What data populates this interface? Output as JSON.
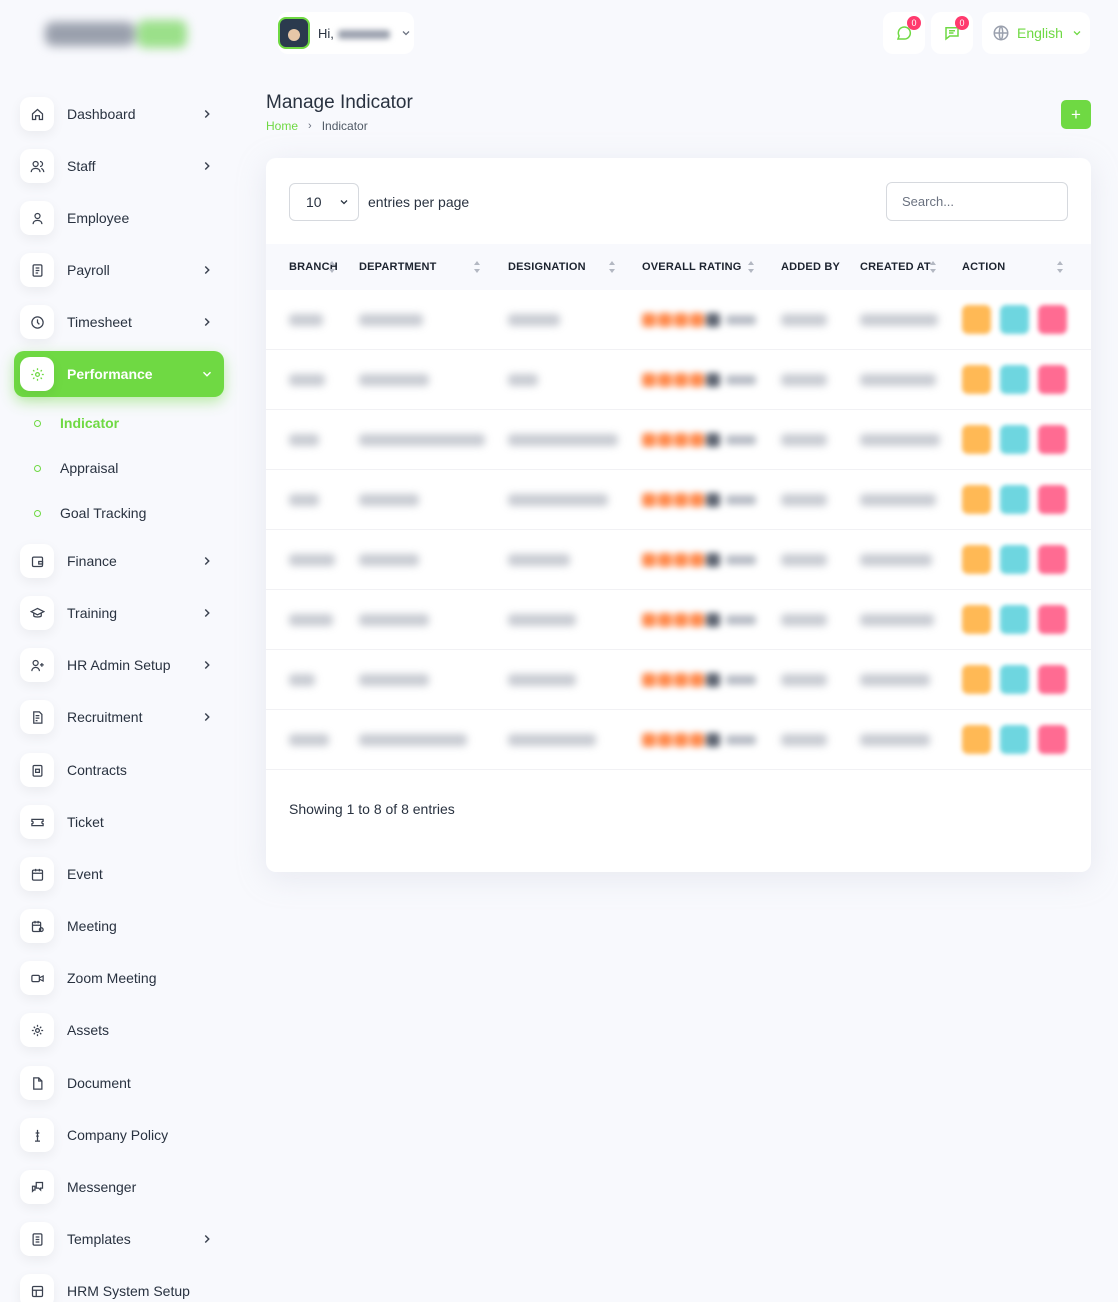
{
  "sidebar": {
    "items": [
      {
        "label": "Dashboard",
        "icon": "home-icon",
        "chevron": true
      },
      {
        "label": "Staff",
        "icon": "users-icon",
        "chevron": true
      },
      {
        "label": "Employee",
        "icon": "user-icon",
        "chevron": false
      },
      {
        "label": "Payroll",
        "icon": "receipt-icon",
        "chevron": true
      },
      {
        "label": "Timesheet",
        "icon": "clock-icon",
        "chevron": true
      },
      {
        "label": "Performance",
        "icon": "gear-icon",
        "chevron": true,
        "active": true
      },
      {
        "label": "Finance",
        "icon": "wallet-icon",
        "chevron": true
      },
      {
        "label": "Training",
        "icon": "school-icon",
        "chevron": true
      },
      {
        "label": "HR Admin Setup",
        "icon": "user-plus-icon",
        "chevron": true
      },
      {
        "label": "Recruitment",
        "icon": "file-certificate-icon",
        "chevron": true
      },
      {
        "label": "Contracts",
        "icon": "contract-icon",
        "chevron": false
      },
      {
        "label": "Ticket",
        "icon": "ticket-icon",
        "chevron": false
      },
      {
        "label": "Event",
        "icon": "calendar-icon",
        "chevron": false
      },
      {
        "label": "Meeting",
        "icon": "calendar-time-icon",
        "chevron": false
      },
      {
        "label": "Zoom Meeting",
        "icon": "video-icon",
        "chevron": false
      },
      {
        "label": "Assets",
        "icon": "puzzle-icon",
        "chevron": false
      },
      {
        "label": "Document",
        "icon": "file-icon",
        "chevron": false
      },
      {
        "label": "Company Policy",
        "icon": "policy-icon",
        "chevron": false
      },
      {
        "label": "Messenger",
        "icon": "messages-icon",
        "chevron": false
      },
      {
        "label": "Templates",
        "icon": "template-icon",
        "chevron": true
      },
      {
        "label": "HRM System Setup",
        "icon": "table-icon",
        "chevron": false
      }
    ],
    "sub_items": [
      "Indicator",
      "Appraisal",
      "Goal Tracking"
    ]
  },
  "topbar": {
    "greeting": "Hi,",
    "notification_count": "0",
    "message_count": "0",
    "language": "English"
  },
  "page": {
    "title": "Manage Indicator",
    "breadcrumb_home": "Home",
    "breadcrumb_current": "Indicator",
    "add_label": "+"
  },
  "table": {
    "per_page": "10",
    "per_page_label": "entries per page",
    "search_placeholder": "Search...",
    "columns": [
      "BRANCH",
      "DEPARTMENT",
      "DESIGNATION",
      "OVERALL RATING",
      "ADDED BY",
      "CREATED AT",
      "ACTION"
    ],
    "row_count": 8,
    "showing": "Showing 1 to 8 of 8 entries"
  },
  "colors": {
    "accent": "#6fd943",
    "badge": "#ff3a6e",
    "edit": "#ffa21d",
    "view": "#3ec9d6",
    "delete": "#ff3a6e"
  }
}
